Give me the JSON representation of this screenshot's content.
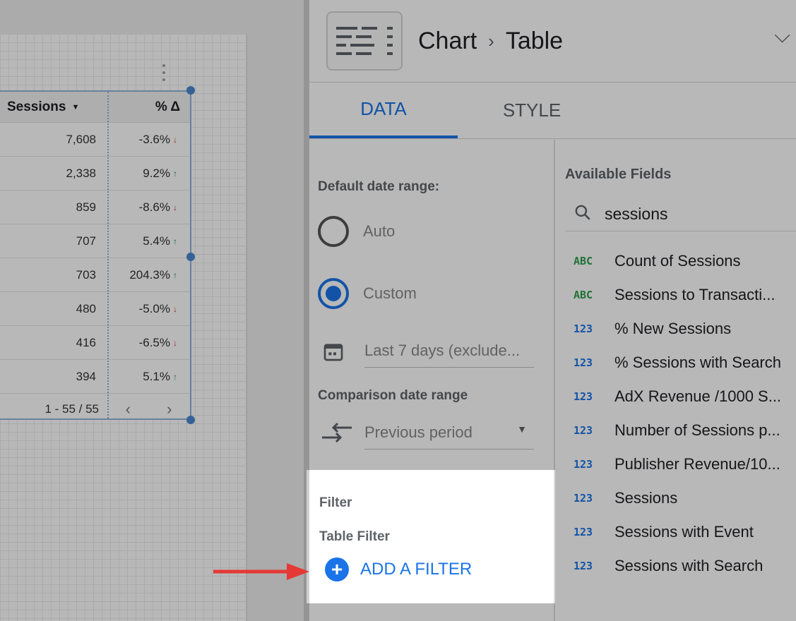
{
  "panel": {
    "breadcrumb_root": "Chart",
    "breadcrumb_sep": "›",
    "breadcrumb_leaf": "Table",
    "collapse_icon": "chevron-down-icon"
  },
  "tabs": [
    {
      "label": "DATA",
      "active": true
    },
    {
      "label": "STYLE",
      "active": false
    }
  ],
  "date_range": {
    "label": "Default date range:",
    "option_auto": "Auto",
    "option_custom": "Custom",
    "selected": "Custom",
    "custom_value": "Last 7 days (exclude...",
    "comparison_label": "Comparison date range",
    "comparison_value": "Previous period"
  },
  "filter": {
    "section_label": "Filter",
    "table_filter_label": "Table Filter",
    "add_label": "ADD A FILTER"
  },
  "available_fields": {
    "title": "Available Fields",
    "search_value": "sessions",
    "items": [
      {
        "type": "ABC",
        "name": "Count of Sessions"
      },
      {
        "type": "ABC",
        "name": "Sessions to Transacti..."
      },
      {
        "type": "123",
        "name": "% New Sessions"
      },
      {
        "type": "123",
        "name": "% Sessions with Search"
      },
      {
        "type": "123",
        "name": "AdX Revenue /1000 S..."
      },
      {
        "type": "123",
        "name": "Number of Sessions p..."
      },
      {
        "type": "123",
        "name": "Publisher Revenue/10..."
      },
      {
        "type": "123",
        "name": "Sessions"
      },
      {
        "type": "123",
        "name": "Sessions with Event"
      },
      {
        "type": "123",
        "name": "Sessions with Search"
      }
    ]
  },
  "table": {
    "col_sessions": "Sessions",
    "col_delta": "% Δ",
    "rows": [
      {
        "sessions": "7,608",
        "delta": "-3.6%",
        "dir": "down"
      },
      {
        "sessions": "2,338",
        "delta": "9.2%",
        "dir": "up"
      },
      {
        "sessions": "859",
        "delta": "-8.6%",
        "dir": "down"
      },
      {
        "sessions": "707",
        "delta": "5.4%",
        "dir": "up"
      },
      {
        "sessions": "703",
        "delta": "204.3%",
        "dir": "up"
      },
      {
        "sessions": "480",
        "delta": "-5.0%",
        "dir": "down"
      },
      {
        "sessions": "416",
        "delta": "-6.5%",
        "dir": "down"
      },
      {
        "sessions": "394",
        "delta": "5.1%",
        "dir": "up"
      }
    ],
    "pagination": "1 - 55 / 55",
    "prev": "‹",
    "next": "›"
  },
  "colors": {
    "accent": "#1a73e8",
    "up": "#1e8e3e",
    "down": "#d93025",
    "annotation_arrow": "#e53935"
  }
}
